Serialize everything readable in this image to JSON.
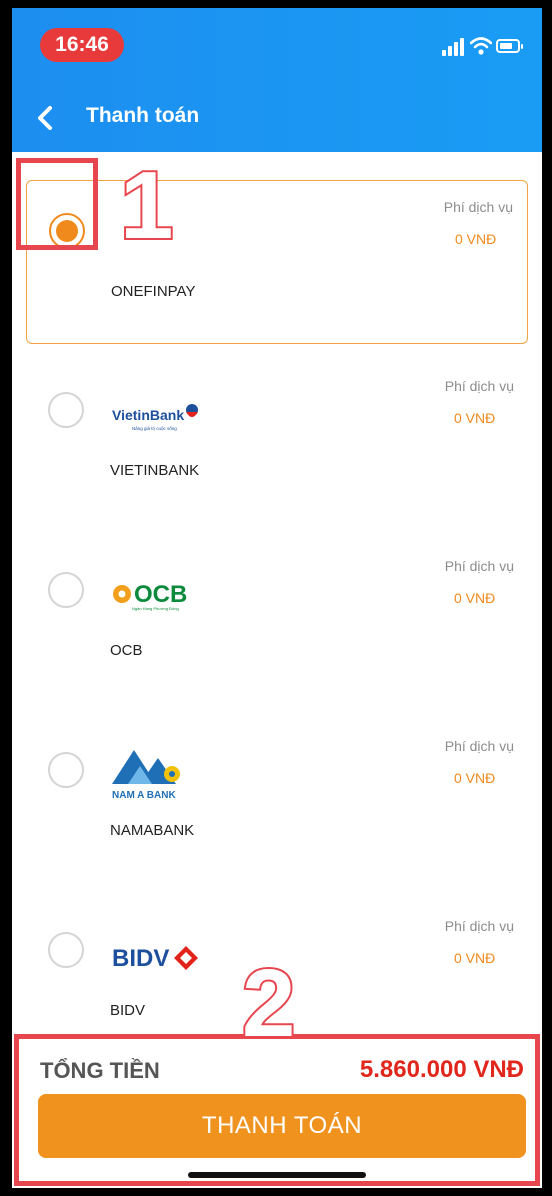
{
  "status_bar": {
    "time": "16:46"
  },
  "header": {
    "title": "Thanh toán"
  },
  "payment_methods": [
    {
      "name": "ONEFINPAY",
      "fee_label": "Phí dịch vụ",
      "fee": "0 VNĐ",
      "selected": true
    },
    {
      "name": "VIETINBANK",
      "fee_label": "Phí dịch vụ",
      "fee": "0 VNĐ",
      "selected": false,
      "logo_text": "VietinBank",
      "logo_sub": "Nâng giá trị cuộc sống"
    },
    {
      "name": "OCB",
      "fee_label": "Phí dịch vụ",
      "fee": "0 VNĐ",
      "selected": false,
      "logo_text": "OCB",
      "logo_sub": "Ngân Hàng Phương Đông"
    },
    {
      "name": "NAMABANK",
      "fee_label": "Phí dịch vụ",
      "fee": "0 VNĐ",
      "selected": false,
      "logo_text": "NAM A BANK"
    },
    {
      "name": "BIDV",
      "fee_label": "Phí dịch vụ",
      "fee": "0 VNĐ",
      "selected": false,
      "logo_text": "BIDV"
    }
  ],
  "footer": {
    "total_label": "TỔNG TIỀN",
    "total_value": "5.860.000 VNĐ",
    "pay_button": "THANH TOÁN"
  },
  "annotations": {
    "step1": "1",
    "step2": "2"
  },
  "colors": {
    "header_blue": "#1a96f2",
    "accent_orange": "#f08a1c",
    "total_red": "#e1261c",
    "annotation_red": "#e8464f"
  }
}
